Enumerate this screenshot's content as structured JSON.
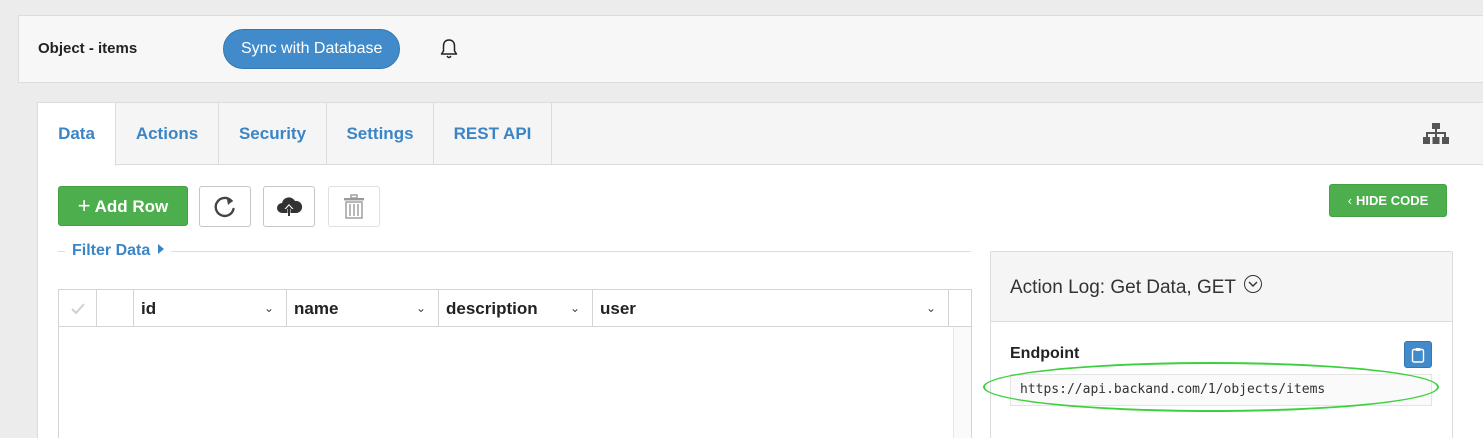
{
  "header": {
    "object_title": "Object - items",
    "sync_button": "Sync with Database",
    "bell_icon": "bell-icon"
  },
  "tabs": [
    {
      "label": "Data",
      "active": true
    },
    {
      "label": "Actions",
      "active": false
    },
    {
      "label": "Security",
      "active": false
    },
    {
      "label": "Settings",
      "active": false
    },
    {
      "label": "REST API",
      "active": false
    }
  ],
  "toolbar": {
    "add_row_label": "Add Row",
    "refresh_icon": "refresh-icon",
    "upload_icon": "cloud-upload-icon",
    "delete_icon": "trash-icon",
    "hide_code_label": "HIDE CODE"
  },
  "filter": {
    "label": "Filter Data"
  },
  "grid": {
    "columns": [
      "id",
      "name",
      "description",
      "user"
    ],
    "rows": []
  },
  "action_log": {
    "title": "Action Log: Get Data, GET",
    "endpoint_label": "Endpoint",
    "endpoint_url": "https://api.backand.com/1/objects/items",
    "copy_icon": "clipboard-icon"
  },
  "colors": {
    "primary_blue": "#428bca",
    "link_blue": "#3b85c5",
    "success_green": "#4cae4c",
    "highlight_green": "#3cd13c"
  }
}
